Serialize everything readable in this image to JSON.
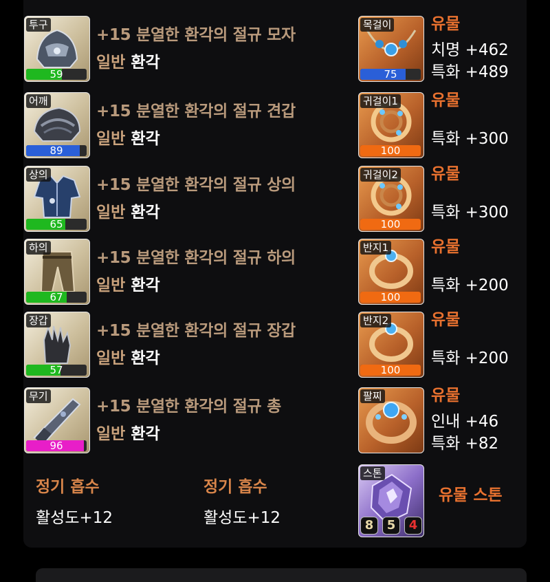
{
  "colors": {
    "quality_green": "#1fb81f",
    "quality_blue": "#2a5fd8",
    "quality_magenta": "#e81ec8",
    "quality_orange": "#f06a12",
    "item_name": "#b99a7c",
    "relic": "#e8712f"
  },
  "gear": [
    {
      "slot": "투구",
      "quality": 59,
      "quality_color": "green",
      "name": "+15 분열한 환각의 절규 모자",
      "grade_a": "일반",
      "grade_b": "환각",
      "icon": "helmet-icon"
    },
    {
      "slot": "어깨",
      "quality": 89,
      "quality_color": "blue",
      "name": "+15 분열한 환각의 절규 견갑",
      "grade_a": "일반",
      "grade_b": "환각",
      "icon": "shoulder-armor-icon"
    },
    {
      "slot": "상의",
      "quality": 65,
      "quality_color": "green",
      "name": "+15 분열한 환각의 절규 상의",
      "grade_a": "일반",
      "grade_b": "환각",
      "icon": "chest-armor-icon"
    },
    {
      "slot": "하의",
      "quality": 67,
      "quality_color": "green",
      "name": "+15 분열한 환각의 절규 하의",
      "grade_a": "일반",
      "grade_b": "환각",
      "icon": "pants-icon"
    },
    {
      "slot": "장갑",
      "quality": 57,
      "quality_color": "green",
      "name": "+15 분열한 환각의 절규 장갑",
      "grade_a": "일반",
      "grade_b": "환각",
      "icon": "gloves-icon"
    },
    {
      "slot": "무기",
      "quality": 96,
      "quality_color": "magenta",
      "name": "+15 분열한 환각의 절규 총",
      "grade_a": "일반",
      "grade_b": "환각",
      "icon": "gun-icon"
    }
  ],
  "accessories": [
    {
      "slot": "목걸이",
      "quality": 75,
      "quality_color": "blue",
      "title": "유물",
      "stats": [
        "치명 +462",
        "특화 +489"
      ],
      "icon": "necklace-icon"
    },
    {
      "slot": "귀걸이1",
      "quality": 100,
      "quality_color": "orange",
      "title": "유물",
      "stats": [
        "특화 +300"
      ],
      "icon": "earring-icon"
    },
    {
      "slot": "귀걸이2",
      "quality": 100,
      "quality_color": "orange",
      "title": "유물",
      "stats": [
        "특화 +300"
      ],
      "icon": "earring-icon"
    },
    {
      "slot": "반지1",
      "quality": 100,
      "quality_color": "orange",
      "title": "유물",
      "stats": [
        "특화 +200"
      ],
      "icon": "ring-icon"
    },
    {
      "slot": "반지2",
      "quality": 100,
      "quality_color": "orange",
      "title": "유물",
      "stats": [
        "특화 +200"
      ],
      "icon": "ring-icon"
    },
    {
      "slot": "팔찌",
      "title": "유물",
      "stats": [
        "인내 +46",
        "특화 +82"
      ],
      "icon": "bracelet-icon"
    }
  ],
  "absorb": [
    {
      "title": "정기 흡수",
      "value": "활성도+12"
    },
    {
      "title": "정기 흡수",
      "value": "활성도+12"
    }
  ],
  "stone": {
    "slot": "스톤",
    "title": "유물 스톤",
    "values": [
      "8",
      "5",
      "4"
    ],
    "value_colors": [
      "#e8d9a8",
      "#e8d9a8",
      "#e83030"
    ],
    "icon": "ability-stone-icon"
  }
}
